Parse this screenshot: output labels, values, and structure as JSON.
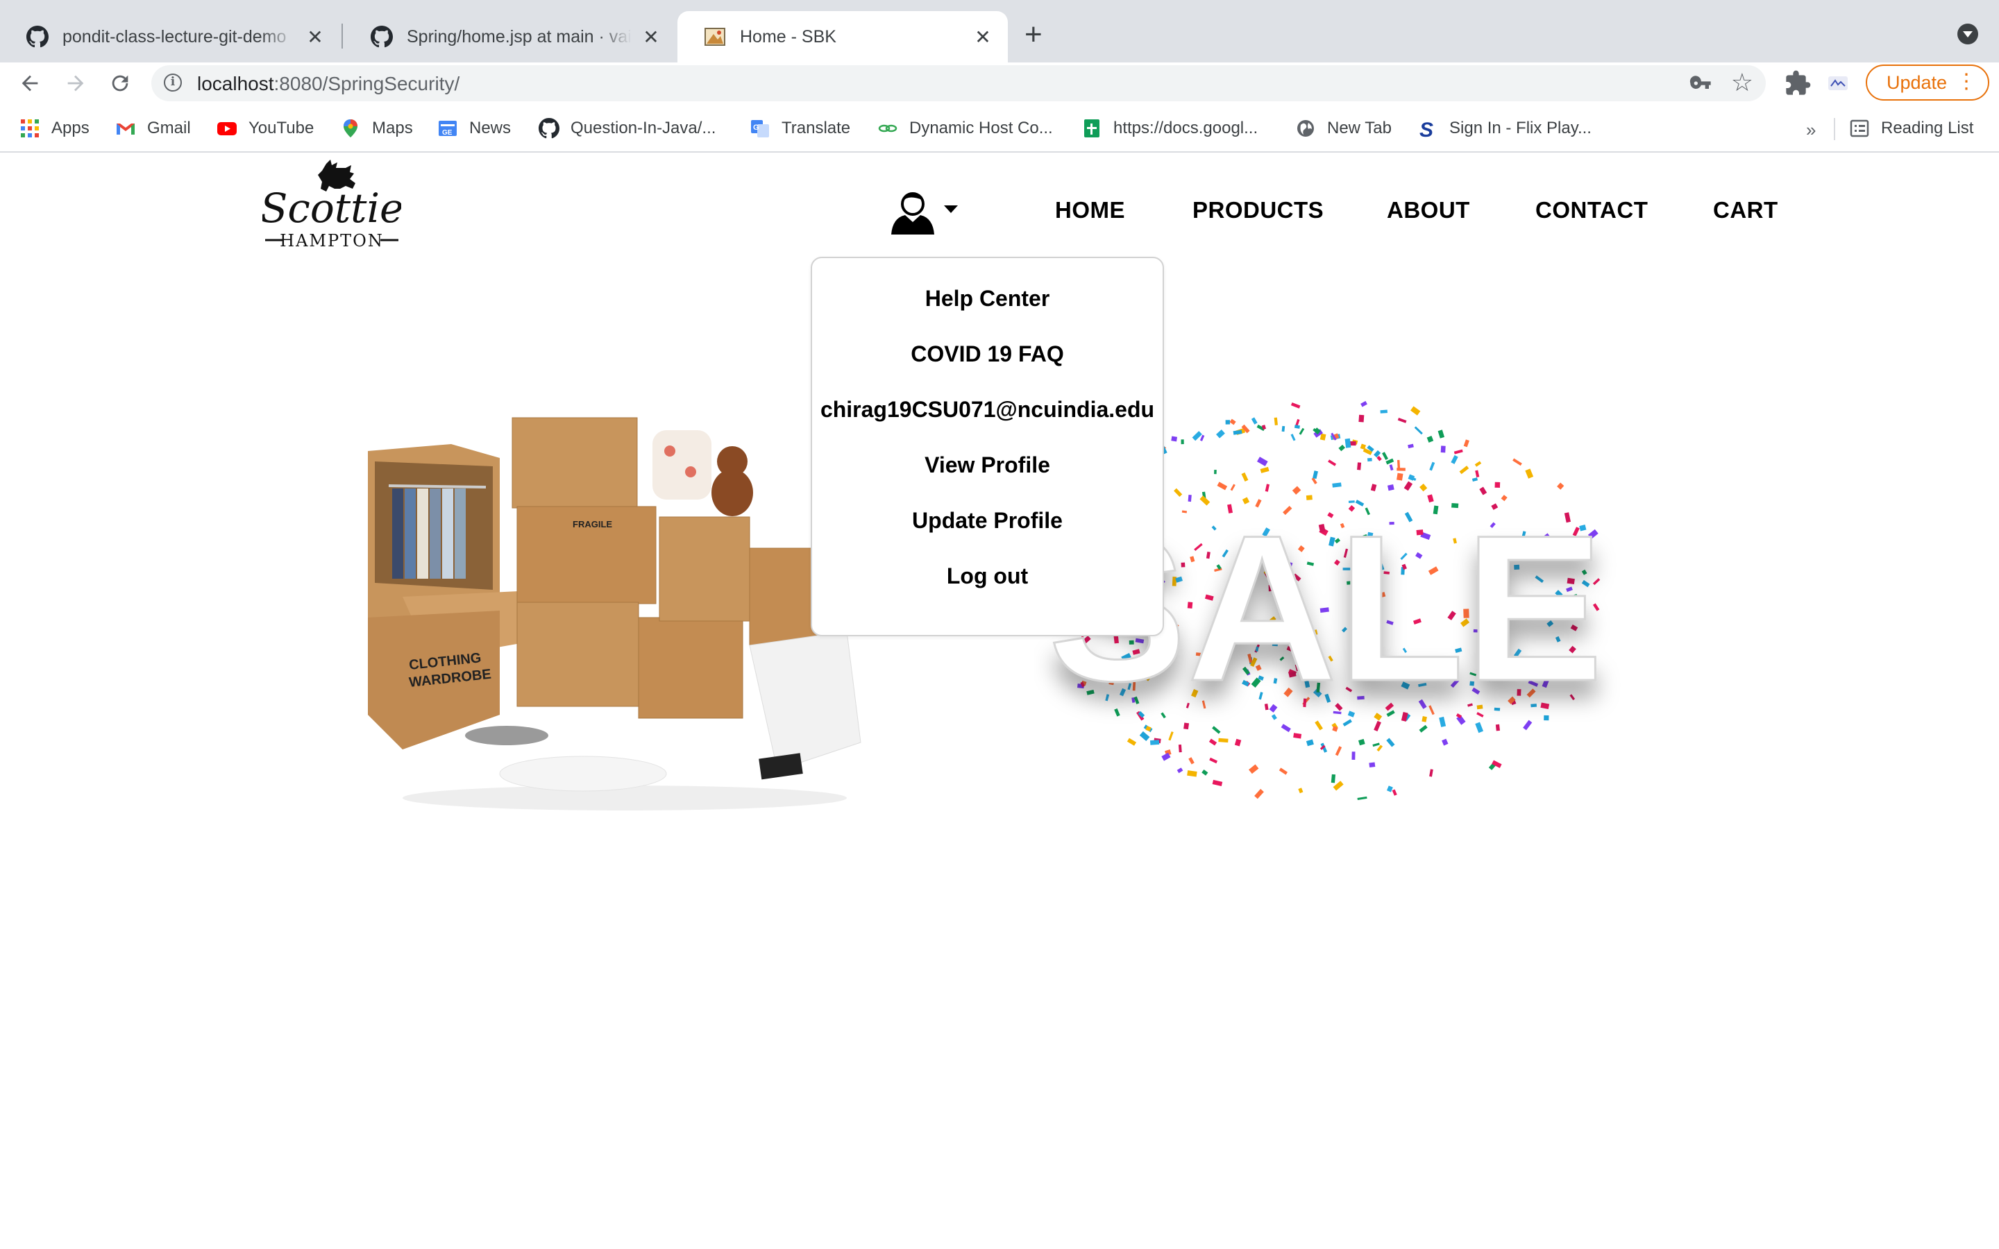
{
  "browser": {
    "tabs": [
      {
        "title": "pondit-class-lecture-git-demo",
        "icon": "github-icon",
        "active": false
      },
      {
        "title": "Spring/home.jsp at main · vaish",
        "icon": "github-icon",
        "active": false
      },
      {
        "title": "Home - SBK",
        "icon": "page-favicon",
        "active": true
      }
    ],
    "address": {
      "host": "localhost",
      "rest": ":8080/SpringSecurity/"
    },
    "update_label": "Update",
    "bookmarks": [
      {
        "label": "Apps",
        "icon": "apps-grid-icon"
      },
      {
        "label": "Gmail",
        "icon": "gmail-icon"
      },
      {
        "label": "YouTube",
        "icon": "youtube-icon"
      },
      {
        "label": "Maps",
        "icon": "maps-pin-icon"
      },
      {
        "label": "News",
        "icon": "news-icon"
      },
      {
        "label": "Question-In-Java/...",
        "icon": "github-icon"
      },
      {
        "label": "Translate",
        "icon": "translate-icon"
      },
      {
        "label": "Dynamic Host Co...",
        "icon": "link-icon"
      },
      {
        "label": "https://docs.googl...",
        "icon": "sheets-icon"
      },
      {
        "label": "New Tab",
        "icon": "globe-icon"
      },
      {
        "label": "Sign In - Flix Play...",
        "icon": "s-logo-icon"
      }
    ],
    "bookmarks_more": "»",
    "reading_list": "Reading List"
  },
  "site": {
    "logo_text": "Scottie",
    "logo_subtext": "HAMPTON",
    "nav": [
      "HOME",
      "PRODUCTS",
      "ABOUT",
      "CONTACT",
      "CART"
    ],
    "user_menu": [
      "Help Center",
      "COVID 19 FAQ",
      "chirag19CSU071@ncuindia.edu",
      "View Profile",
      "Update Profile",
      "Log out"
    ],
    "hero_sale_text": "SALE",
    "box_labels": [
      "CLOTHING",
      "WARDROBE",
      "FRAGILE"
    ]
  },
  "colors": {
    "accent_update": "#e8710a",
    "tabstrip": "#dee1e6"
  }
}
